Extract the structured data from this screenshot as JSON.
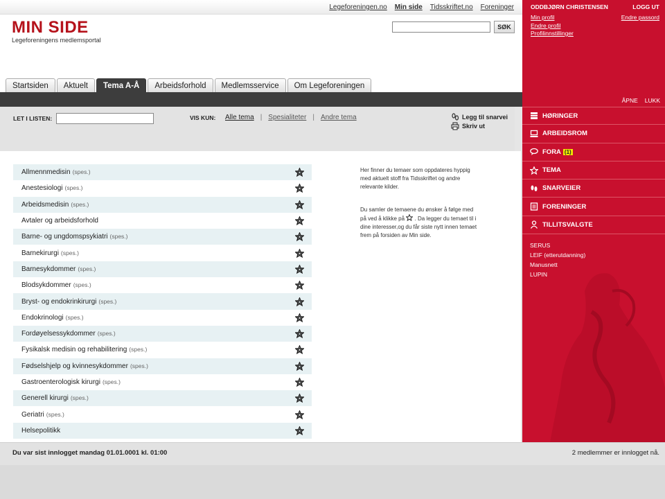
{
  "top_nav": {
    "links": [
      "Legeforeningen.no",
      "Min side",
      "Tidsskriftet.no",
      "Foreninger"
    ],
    "active": "Min side"
  },
  "header": {
    "logo": "MIN SIDE",
    "subtitle": "Legeforeningens medlemsportal",
    "search_button": "SØK",
    "search_value": ""
  },
  "tabs": [
    {
      "label": "Startsiden",
      "active": false
    },
    {
      "label": "Aktuelt",
      "active": false
    },
    {
      "label": "Tema A-Å",
      "active": true
    },
    {
      "label": "Arbeidsforhold",
      "active": false
    },
    {
      "label": "Medlemsservice",
      "active": false
    },
    {
      "label": "Om Legeforeningen",
      "active": false
    }
  ],
  "filter": {
    "search_label": "LET I LISTEN:",
    "search_value": "",
    "vis_kun_label": "VIS KUN:",
    "options": [
      "Alle tema",
      "Spesialiteter",
      "Andre tema"
    ],
    "selected": "Alle tema",
    "add_shortcut": "Legg til snarvei",
    "print": "Skriv ut"
  },
  "topics": [
    {
      "name": "Allmennmedisin",
      "tag": "(spes.)"
    },
    {
      "name": "Anestesiologi",
      "tag": "(spes.)"
    },
    {
      "name": "Arbeidsmedisin",
      "tag": "(spes.)"
    },
    {
      "name": "Avtaler og arbeidsforhold",
      "tag": ""
    },
    {
      "name": "Barne- og ungdomspsykiatri",
      "tag": "(spes.)"
    },
    {
      "name": "Barnekirurgi",
      "tag": "(spes.)"
    },
    {
      "name": "Barnesykdommer",
      "tag": "(spes.)"
    },
    {
      "name": "Blodsykdommer",
      "tag": "(spes.)"
    },
    {
      "name": "Bryst- og endokrinkirurgi",
      "tag": "(spes.)"
    },
    {
      "name": "Endokrinologi",
      "tag": "(spes.)"
    },
    {
      "name": "Fordøyelsessykdommer",
      "tag": "(spes.)"
    },
    {
      "name": "Fysikalsk medisin og rehabilitering",
      "tag": "(spes.)"
    },
    {
      "name": "Fødselshjelp og kvinnesykdommer",
      "tag": "(spes.)"
    },
    {
      "name": "Gastroenterologisk kirurgi",
      "tag": "(spes.)"
    },
    {
      "name": "Generell kirurgi",
      "tag": "(spes.)"
    },
    {
      "name": "Geriatri",
      "tag": "(spes.)"
    },
    {
      "name": "Helsepolitikk",
      "tag": ""
    }
  ],
  "info": {
    "paragraph1": "Her finner du temaer som oppdateres hyppig med aktuelt stoff fra Tidsskriftet og andre relevante kilder.",
    "paragraph2_before": "Du samler de temaene du ønsker å følge med på ved å klikke på",
    "paragraph2_after": ". Da legger du temaet til i dine interesser,og du får siste nytt innen temaet frem på forsiden av Min side."
  },
  "sidebar": {
    "user_name": "ODDBJØRN CHRISTENSEN",
    "logout": "LOGG UT",
    "profile_links": [
      "Min profil",
      "Endre profil",
      "Profilinnstillinger"
    ],
    "change_password": "Endre passord",
    "open": "ÅPNE",
    "close": "LUKK",
    "menu": [
      {
        "label": "HØRINGER",
        "icon": "hearing-icon"
      },
      {
        "label": "ARBEIDSROM",
        "icon": "computer-icon"
      },
      {
        "label": "FORA",
        "icon": "chat-icon",
        "badge": "(1)"
      },
      {
        "label": "TEMA",
        "icon": "star-icon"
      },
      {
        "label": "SNARVEIER",
        "icon": "footprints-icon"
      },
      {
        "label": "FORENINGER",
        "icon": "document-icon"
      },
      {
        "label": "TILLITSVALGTE",
        "icon": "person-icon"
      }
    ],
    "extra_links": [
      "SERUS",
      "LEIF (etterutdanning)",
      "Manusnett",
      "LUPIN"
    ]
  },
  "footer": {
    "last_login": "Du var sist innlogget mandag 01.01.0001 kl. 01:00",
    "online": "2 medlemmer er innlogget nå."
  },
  "colors": {
    "brand_red": "#c8102e",
    "dark_bar": "#3d3d3d",
    "row_stripe": "#e7f1f3"
  }
}
